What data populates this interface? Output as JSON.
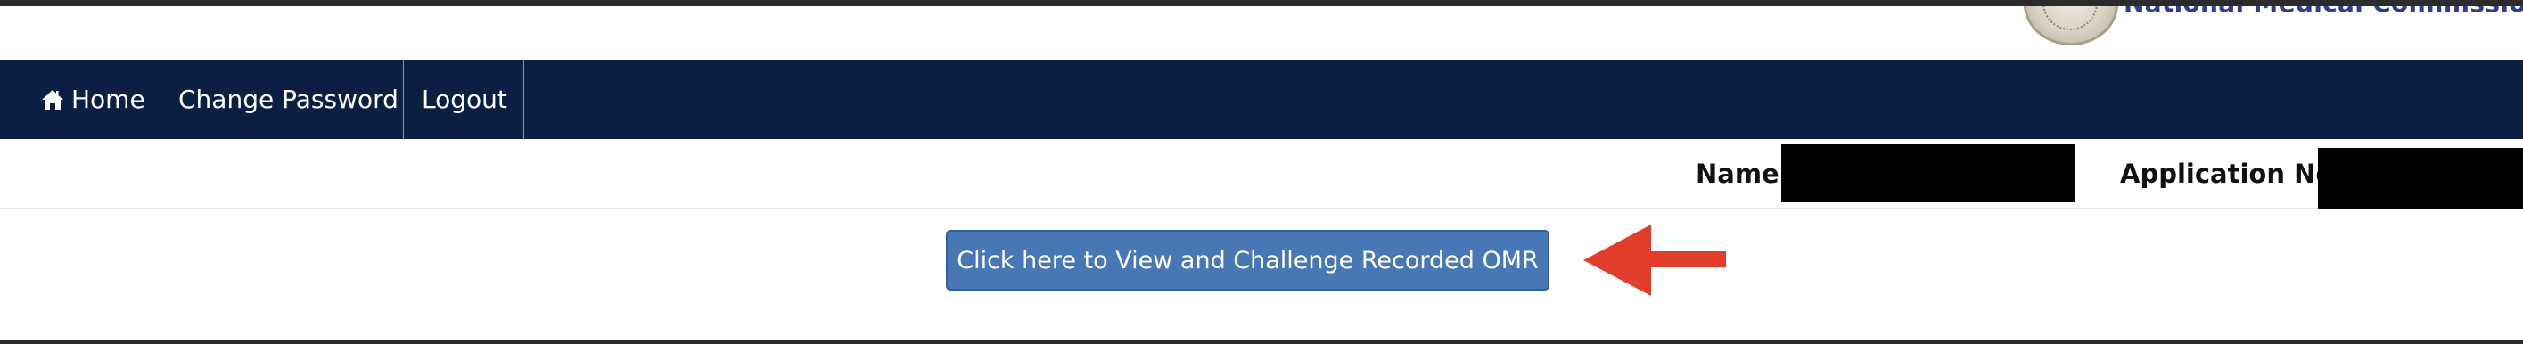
{
  "header": {
    "brand_text": "National Medical Commission",
    "logo_icon": "nmc-emblem-icon"
  },
  "nav": {
    "items": [
      {
        "label": "Home",
        "icon": "home-icon"
      },
      {
        "label": "Change Password"
      },
      {
        "label": "Logout"
      }
    ]
  },
  "info": {
    "name_label": "Name:",
    "application_no_label": "Application No:"
  },
  "action": {
    "button_label": "Click here to View and Challenge Recorded OMR",
    "arrow_icon": "red-left-arrow-icon"
  },
  "colors": {
    "navbar_bg": "#0b1f42",
    "button_bg": "#4877b5",
    "brand_text": "#2d3e91",
    "arrow": "#e23d2a"
  }
}
